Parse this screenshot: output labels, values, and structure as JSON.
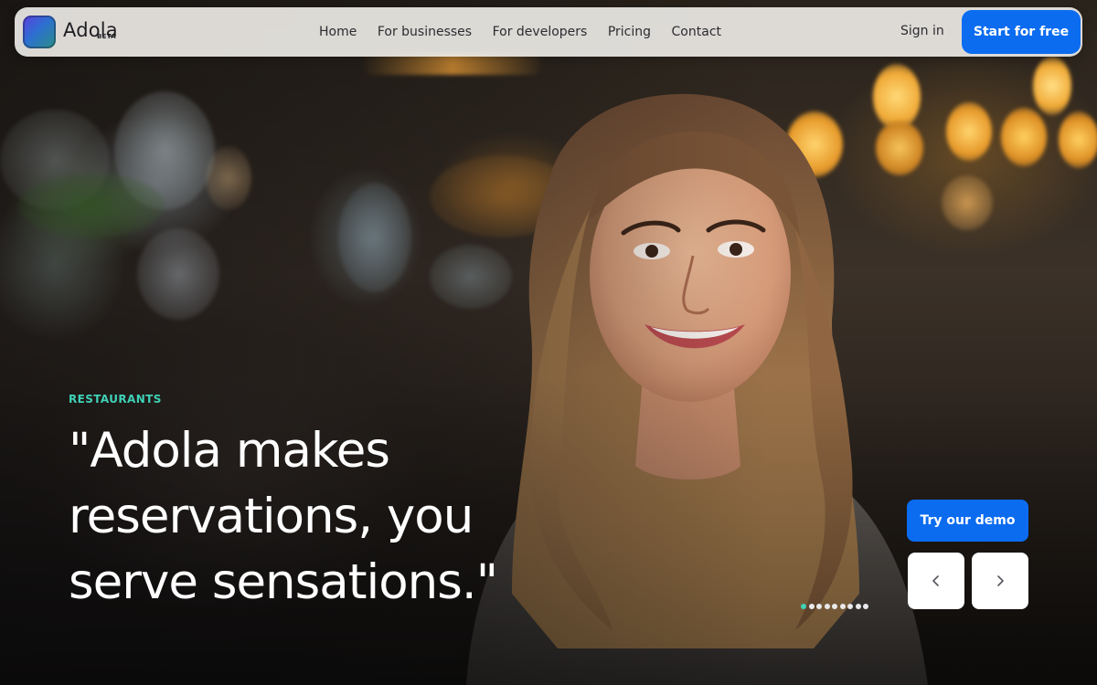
{
  "brand": {
    "name": "Adola",
    "tag": "BETA"
  },
  "nav": {
    "links": [
      "Home",
      "For businesses",
      "For developers",
      "Pricing",
      "Contact"
    ],
    "sign_in": "Sign in",
    "cta": "Start for free"
  },
  "hero": {
    "eyebrow": "RESTAURANTS",
    "quote_line1": "\"Adola makes",
    "quote_line2": "reservations, you",
    "quote_line3": "serve sensations.\"",
    "demo_button": "Try our demo",
    "prev_icon": "chevron-left-icon",
    "next_icon": "chevron-right-icon",
    "slides_total": 9,
    "active_slide": 1
  },
  "colors": {
    "accent_blue": "#0b6cf0",
    "accent_teal": "#3fd1b6",
    "nav_bg": "#ebe8e4"
  }
}
